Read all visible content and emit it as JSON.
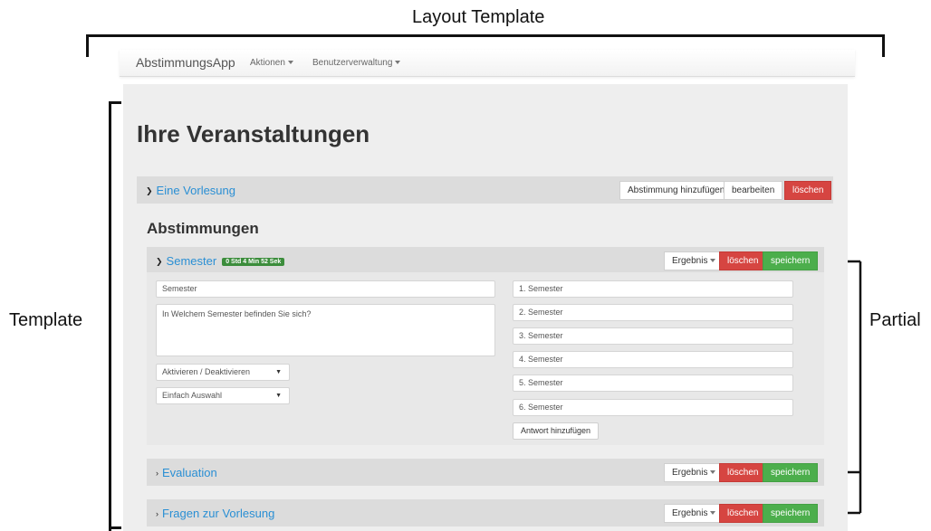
{
  "annotations": {
    "layout_template": "Layout Template",
    "template": "Template",
    "partial": "Partial"
  },
  "navbar": {
    "brand": "AbstimmungsApp",
    "menu_actions": "Aktionen",
    "menu_users": "Benutzerverwaltung"
  },
  "page": {
    "title": "Ihre Veranstaltungen"
  },
  "lecture": {
    "title": "Eine Vorlesung",
    "add_vote_label": "Abstimmung hinzufügen",
    "edit_label": "bearbeiten",
    "delete_label": "löschen"
  },
  "votes_heading": "Abstimmungen",
  "votes": [
    {
      "title": "Semester",
      "timer": "0 Std 4 Min 52 Sek",
      "result_label": "Ergebnis",
      "delete_label": "löschen",
      "save_label": "speichern"
    },
    {
      "title": "Evaluation",
      "result_label": "Ergebnis",
      "delete_label": "löschen",
      "save_label": "speichern"
    },
    {
      "title": "Fragen zur Vorlesung",
      "result_label": "Ergebnis",
      "delete_label": "löschen",
      "save_label": "speichern"
    }
  ],
  "vote_form": {
    "name_value": "Semester",
    "question_value": "In Welchem Semester befinden Sie sich?",
    "activation_select": "Aktivieren / Deaktivieren",
    "type_select": "Einfach Auswahl",
    "answers": [
      "1. Semester",
      "2. Semester",
      "3. Semester",
      "4. Semester",
      "5. Semester",
      "6. Semester"
    ],
    "add_answer_label": "Antwort hinzufügen"
  },
  "colors": {
    "link": "#2a8fd4",
    "danger": "#d64541",
    "success": "#4cae4c",
    "badge": "#3c8d3c"
  }
}
